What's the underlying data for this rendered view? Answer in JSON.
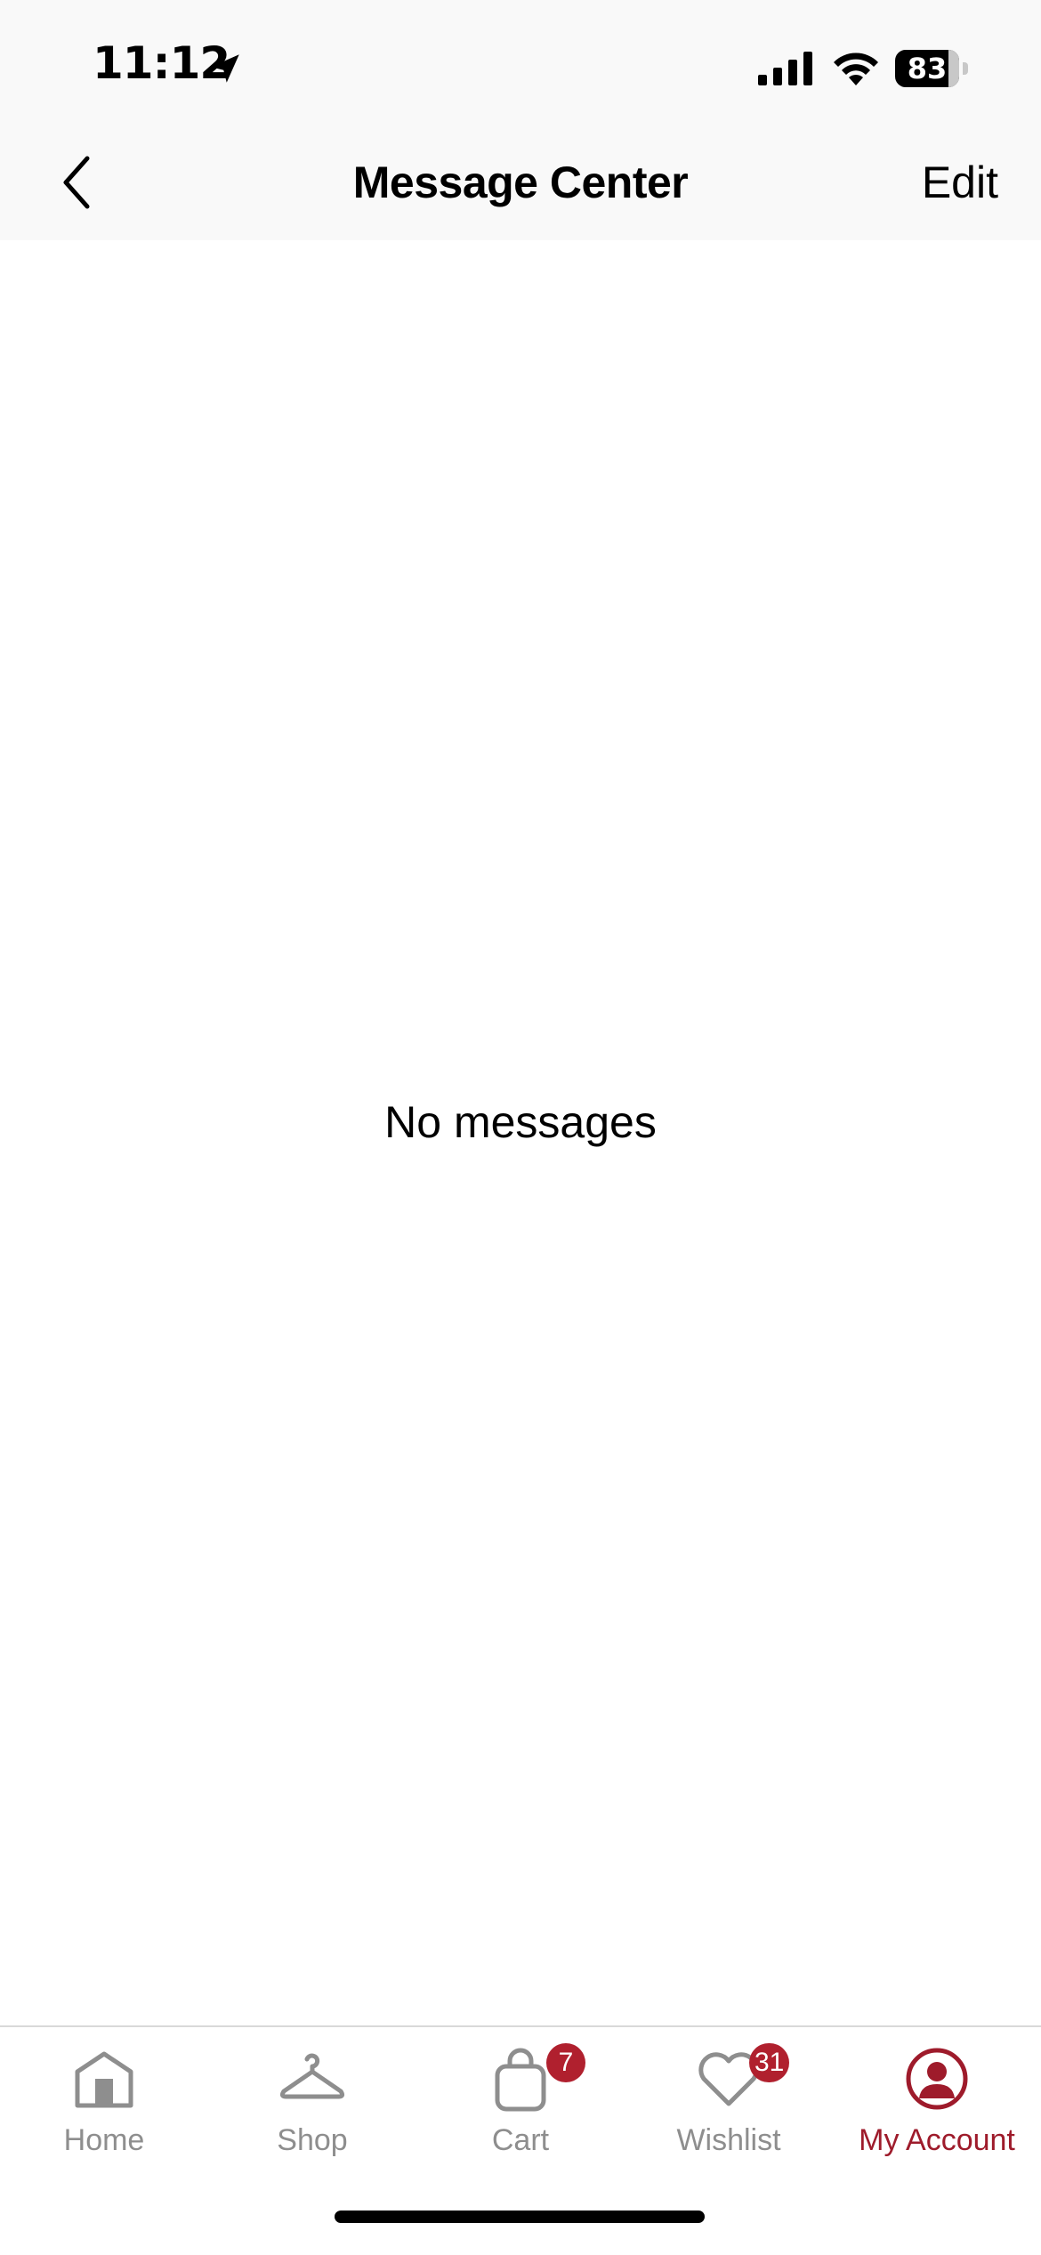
{
  "status_bar": {
    "time": "11:12",
    "battery_level": "83",
    "icons": [
      "location-arrow-icon",
      "cellular-signal-icon",
      "wifi-icon",
      "battery-icon"
    ]
  },
  "nav": {
    "title": "Message Center",
    "edit_label": "Edit",
    "back_icon": "chevron-left-icon"
  },
  "content": {
    "empty_text": "No messages"
  },
  "tab_bar": {
    "tabs": [
      {
        "label": "Home",
        "icon": "home-icon",
        "active": false
      },
      {
        "label": "Shop",
        "icon": "hanger-icon",
        "active": false
      },
      {
        "label": "Cart",
        "icon": "shopping-bag-icon",
        "active": false,
        "badge": "7"
      },
      {
        "label": "Wishlist",
        "icon": "heart-icon",
        "active": false,
        "badge": "31"
      },
      {
        "label": "My Account",
        "icon": "account-circle-icon",
        "active": true
      }
    ]
  },
  "colors": {
    "accent": "#9e1b2b",
    "badge": "#b0202e",
    "inactive": "#8e8e8e",
    "bar_background": "#f9f9f9"
  }
}
